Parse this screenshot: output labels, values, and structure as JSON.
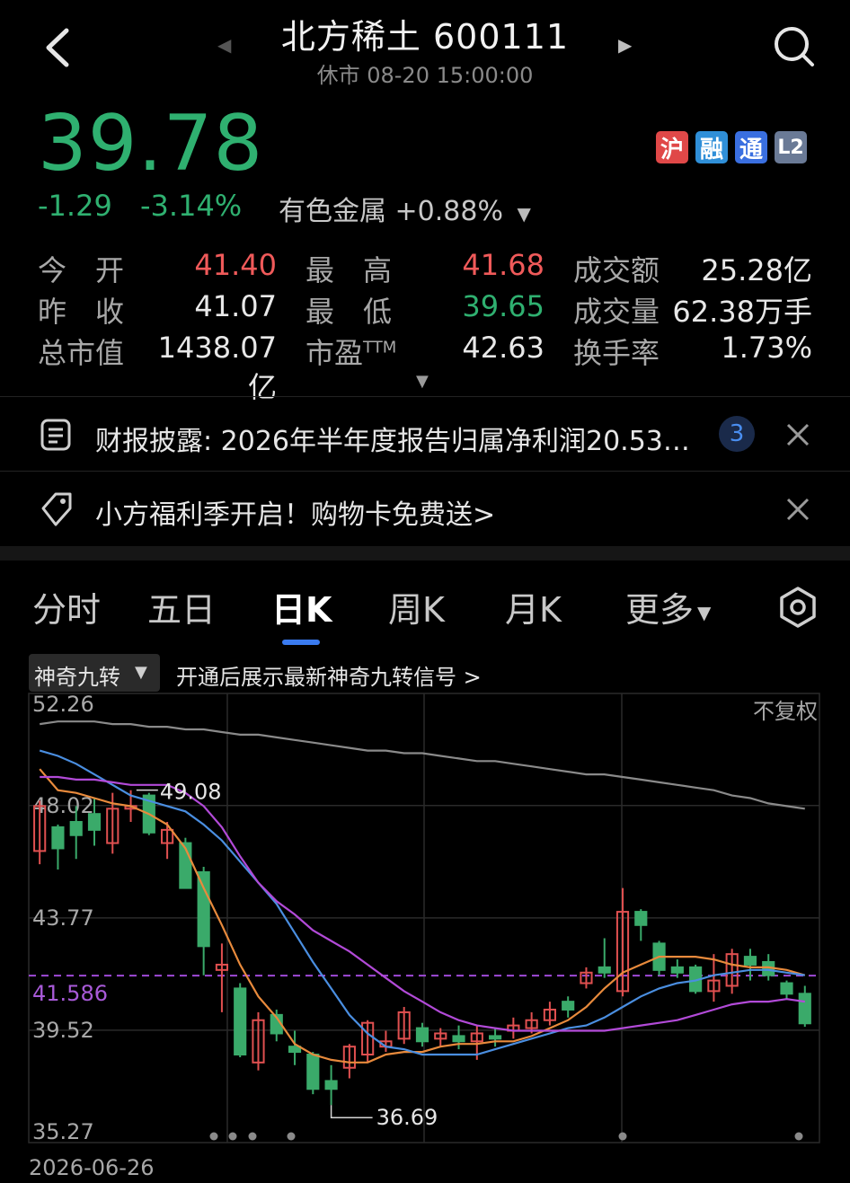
{
  "header": {
    "title": "北方稀土 600111",
    "status": "休市 08-20 15:00:00",
    "prev_arrow": "◀",
    "next_arrow": "▶"
  },
  "quote": {
    "price": "39.78",
    "change": "-1.29",
    "change_pct": "-3.14%",
    "sector": "有色金属 +0.88%",
    "sector_arrow": "▼",
    "badges": [
      {
        "label": "沪",
        "color": "#e04848"
      },
      {
        "label": "融",
        "color": "#2f8fd8"
      },
      {
        "label": "通",
        "color": "#3a6fe0"
      },
      {
        "label": "L2",
        "color": "#6a7a96"
      }
    ]
  },
  "stats": {
    "open_label": "今　开",
    "open": "41.40",
    "high_label": "最　高",
    "high": "41.68",
    "amount_label": "成交额",
    "amount": "25.28亿",
    "prev_label": "昨　收",
    "prev": "41.07",
    "low_label": "最　低",
    "low": "39.65",
    "volume_label": "成交量",
    "volume": "62.38万手",
    "mcap_label": "总市值",
    "mcap": "1438.07亿",
    "pe_label": "市盈",
    "pe_sup": "TTM",
    "pe": "42.63",
    "turnover_label": "换手率",
    "turnover": "1.73%",
    "expand_arrow": "▼"
  },
  "banners": [
    {
      "text": "财报披露: 2026年半年度报告归属净利润20.53…",
      "count": "3"
    },
    {
      "text": "小方福利季开启！购物卡免费送>"
    }
  ],
  "tabs": [
    "分时",
    "五日",
    "日K",
    "周K",
    "月K",
    "更多"
  ],
  "active_tab": "日K",
  "more_arrow": "▼",
  "indicator": {
    "name": "神奇九转",
    "hint": "开通后展示最新神奇九转信号 >",
    "arrow": "▼"
  },
  "chart_data": {
    "type": "candlestick",
    "y_labels": [
      "52.26",
      "48.02",
      "43.77",
      "41.586",
      "39.52",
      "35.27"
    ],
    "ylim": [
      35.27,
      52.26
    ],
    "fq_label": "不复权",
    "start_date": "2026-06-26",
    "max_label": "49.08",
    "min_label": "36.69",
    "ref_price": 41.586,
    "candles": [
      {
        "o": 46.3,
        "c": 48.0,
        "h": 48.2,
        "l": 45.8
      },
      {
        "o": 47.2,
        "c": 46.4,
        "h": 47.3,
        "l": 45.6
      },
      {
        "o": 47.4,
        "c": 46.9,
        "h": 48.0,
        "l": 46.0
      },
      {
        "o": 47.7,
        "c": 47.1,
        "h": 48.3,
        "l": 46.5
      },
      {
        "o": 46.6,
        "c": 47.9,
        "h": 48.5,
        "l": 46.2
      },
      {
        "o": 47.9,
        "c": 48.0,
        "h": 48.6,
        "l": 47.4
      },
      {
        "o": 48.4,
        "c": 47.0,
        "h": 48.5,
        "l": 46.9
      },
      {
        "o": 46.6,
        "c": 47.1,
        "h": 47.4,
        "l": 46.0
      },
      {
        "o": 46.6,
        "c": 44.9,
        "h": 46.8,
        "l": 44.9
      },
      {
        "o": 45.5,
        "c": 42.7,
        "h": 45.7,
        "l": 41.6
      },
      {
        "o": 41.8,
        "c": 42.0,
        "h": 42.8,
        "l": 40.2
      },
      {
        "o": 41.1,
        "c": 38.6,
        "h": 41.3,
        "l": 38.5
      },
      {
        "o": 38.3,
        "c": 39.9,
        "h": 40.2,
        "l": 38.0
      },
      {
        "o": 40.1,
        "c": 39.4,
        "h": 40.3,
        "l": 39.1
      },
      {
        "o": 38.9,
        "c": 38.7,
        "h": 39.5,
        "l": 38.2
      },
      {
        "o": 38.6,
        "c": 37.3,
        "h": 38.7,
        "l": 37.1
      },
      {
        "o": 37.6,
        "c": 37.3,
        "h": 38.2,
        "l": 36.69
      },
      {
        "o": 38.1,
        "c": 38.9,
        "h": 39.0,
        "l": 37.7
      },
      {
        "o": 38.6,
        "c": 39.8,
        "h": 39.9,
        "l": 38.3
      },
      {
        "o": 38.9,
        "c": 39.1,
        "h": 39.5,
        "l": 38.7
      },
      {
        "o": 39.2,
        "c": 40.2,
        "h": 40.4,
        "l": 39.0
      },
      {
        "o": 39.6,
        "c": 39.1,
        "h": 39.8,
        "l": 38.9
      },
      {
        "o": 39.2,
        "c": 39.4,
        "h": 39.6,
        "l": 38.9
      },
      {
        "o": 39.3,
        "c": 39.1,
        "h": 39.7,
        "l": 38.8
      },
      {
        "o": 39.1,
        "c": 39.4,
        "h": 39.7,
        "l": 38.4
      },
      {
        "o": 39.3,
        "c": 39.2,
        "h": 39.6,
        "l": 38.9
      },
      {
        "o": 39.5,
        "c": 39.7,
        "h": 40.0,
        "l": 39.2
      },
      {
        "o": 39.6,
        "c": 39.9,
        "h": 40.2,
        "l": 39.4
      },
      {
        "o": 39.9,
        "c": 40.3,
        "h": 40.6,
        "l": 39.7
      },
      {
        "o": 40.6,
        "c": 40.3,
        "h": 40.8,
        "l": 40.0
      },
      {
        "o": 41.3,
        "c": 41.7,
        "h": 41.9,
        "l": 41.1
      },
      {
        "o": 41.9,
        "c": 41.7,
        "h": 43.0,
        "l": 41.5
      },
      {
        "o": 41.0,
        "c": 44.0,
        "h": 44.9,
        "l": 40.8
      },
      {
        "o": 44.0,
        "c": 43.5,
        "h": 44.1,
        "l": 42.9
      },
      {
        "o": 42.8,
        "c": 41.8,
        "h": 42.9,
        "l": 41.6
      },
      {
        "o": 41.9,
        "c": 41.7,
        "h": 42.2,
        "l": 41.5
      },
      {
        "o": 41.9,
        "c": 41.0,
        "h": 42.0,
        "l": 40.9
      },
      {
        "o": 41.0,
        "c": 41.4,
        "h": 42.4,
        "l": 40.6
      },
      {
        "o": 41.2,
        "c": 42.4,
        "h": 42.6,
        "l": 40.9
      },
      {
        "o": 42.3,
        "c": 42.0,
        "h": 42.6,
        "l": 41.4
      },
      {
        "o": 42.1,
        "c": 41.6,
        "h": 42.4,
        "l": 41.4
      },
      {
        "o": 41.3,
        "c": 40.9,
        "h": 41.4,
        "l": 40.7
      },
      {
        "o": 40.9,
        "c": 39.78,
        "h": 41.2,
        "l": 39.65
      }
    ],
    "ma_lines": [
      {
        "color": "#e88a3c",
        "values": [
          49.4,
          48.6,
          48.5,
          48.3,
          48.1,
          48.0,
          47.7,
          47.3,
          46.4,
          44.9,
          43.5,
          42.0,
          40.8,
          40.0,
          39.0,
          38.6,
          38.4,
          38.3,
          38.3,
          38.6,
          38.7,
          38.7,
          38.9,
          39.0,
          39.0,
          39.1,
          39.1,
          39.3,
          39.6,
          39.9,
          40.4,
          41.1,
          41.7,
          42.0,
          42.3,
          42.3,
          42.3,
          42.2,
          42.0,
          41.9,
          41.9,
          41.8,
          41.6
        ]
      },
      {
        "color": "#4a8ee0",
        "values": [
          50.1,
          49.9,
          49.6,
          49.2,
          48.8,
          48.4,
          48.2,
          48.0,
          47.8,
          47.3,
          46.7,
          45.9,
          45.1,
          44.3,
          43.2,
          42.1,
          41.1,
          40.1,
          39.4,
          38.9,
          38.8,
          38.6,
          38.6,
          38.6,
          38.6,
          38.8,
          39.0,
          39.2,
          39.4,
          39.6,
          39.7,
          40.0,
          40.4,
          40.8,
          41.1,
          41.3,
          41.4,
          41.6,
          41.7,
          41.8,
          41.8,
          41.7,
          41.6
        ]
      },
      {
        "color": "#b24ad8",
        "values": [
          49.1,
          49.1,
          49.0,
          49.0,
          48.9,
          48.8,
          48.8,
          48.8,
          48.5,
          48.0,
          47.2,
          46.1,
          45.1,
          44.4,
          43.9,
          43.3,
          42.9,
          42.5,
          42.0,
          41.5,
          41.0,
          40.6,
          40.2,
          39.9,
          39.7,
          39.6,
          39.5,
          39.5,
          39.5,
          39.5,
          39.5,
          39.5,
          39.6,
          39.7,
          39.8,
          39.9,
          40.1,
          40.3,
          40.5,
          40.6,
          40.6,
          40.7,
          40.6
        ]
      },
      {
        "color": "#8a8a8a",
        "values": [
          51.1,
          51.2,
          51.2,
          51.2,
          51.1,
          51.1,
          51.0,
          51.0,
          50.9,
          50.9,
          50.8,
          50.7,
          50.7,
          50.6,
          50.5,
          50.4,
          50.3,
          50.2,
          50.1,
          50.1,
          50.0,
          50.0,
          49.9,
          49.8,
          49.7,
          49.7,
          49.6,
          49.5,
          49.4,
          49.3,
          49.2,
          49.2,
          49.1,
          49.0,
          48.9,
          48.8,
          48.7,
          48.6,
          48.4,
          48.3,
          48.1,
          48.0,
          47.9
        ]
      }
    ]
  }
}
